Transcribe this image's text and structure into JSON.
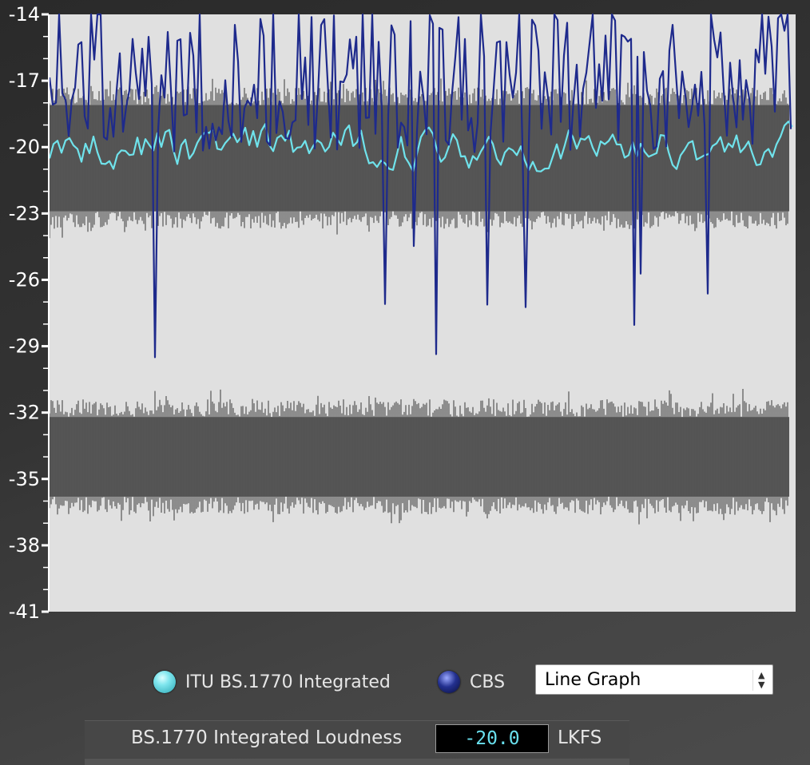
{
  "chart_data": {
    "type": "line",
    "y_ticks": [
      "-14",
      "-17",
      "-20",
      "-23",
      "-26",
      "-29",
      "-32",
      "-35",
      "-38",
      "-41"
    ],
    "ylim": [
      -41,
      -14
    ],
    "series": [
      {
        "name": "ITU BS.1770 Integrated",
        "color": "#6fe3ec",
        "mean": -20.0,
        "spread": 1.0
      },
      {
        "name": "CBS",
        "color": "#1e2a8c",
        "mean": -17.0,
        "spread": 1.8
      }
    ],
    "waveforms": [
      {
        "color": "#555555",
        "center": -20.5,
        "inner_halfwidth": 2.4,
        "outer_halfwidth": 3.2
      },
      {
        "color": "#555555",
        "center": -34.0,
        "inner_halfwidth": 1.8,
        "outer_halfwidth": 2.6
      }
    ],
    "plot_background": "#e0e0e0"
  },
  "legend": {
    "itu_label": "ITU BS.1770 Integrated",
    "cbs_label": "CBS"
  },
  "graph_mode": {
    "selected": "Line Graph"
  },
  "integrated": {
    "label": "BS.1770 Integrated Loudness",
    "value": "-20.0",
    "unit": "LKFS"
  }
}
